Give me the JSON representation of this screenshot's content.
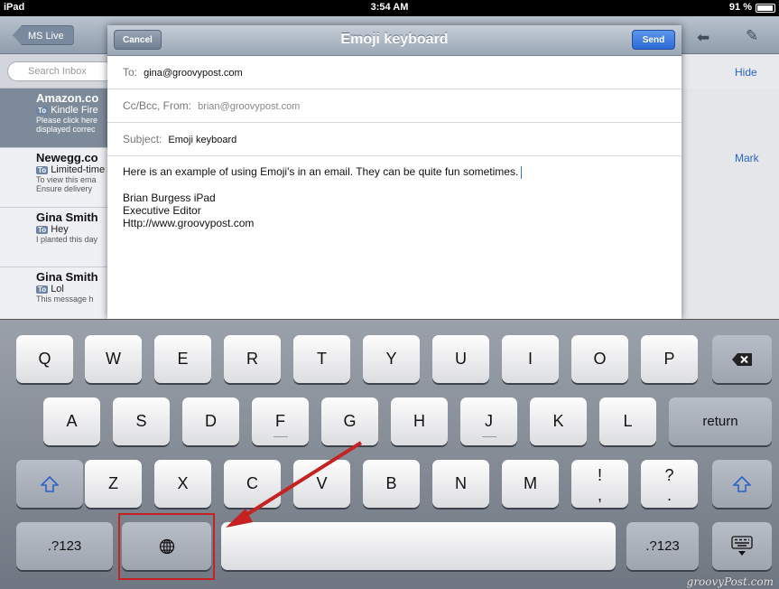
{
  "status_bar": {
    "device": "iPad",
    "time": "3:54 AM",
    "battery": "91 %"
  },
  "inbox": {
    "back_label": "MS Live",
    "search_placeholder": "Search Inbox",
    "hide_label": "Hide",
    "mark_label": "Mark",
    "messages": [
      {
        "from": "Amazon.co",
        "subject": "Kindle Fire",
        "preview1": "Please click here",
        "preview2": "displayed correc"
      },
      {
        "from": "Newegg.co",
        "subject": "Limited-time",
        "preview1": "To view this ema",
        "preview2": "Ensure delivery"
      },
      {
        "from": "Gina Smith",
        "subject": "Hey",
        "preview1": "I planted this day",
        "preview2": ""
      },
      {
        "from": "Gina Smith",
        "subject": "Lol",
        "preview1": "This message h",
        "preview2": ""
      }
    ]
  },
  "compose": {
    "cancel_label": "Cancel",
    "title": "Emoji keyboard",
    "send_label": "Send",
    "to_label": "To:",
    "to_value": "gina@groovypost.com",
    "ccbcc_label": "Cc/Bcc, From:",
    "from_value": "brian@groovypost.com",
    "subject_label": "Subject:",
    "subject_value": "Emoji keyboard",
    "body_line": "Here is an example of using Emoji's in an email. They can be quite fun sometimes.",
    "signature": [
      "Brian Burgess iPad",
      "Executive Editor",
      "Http://www.groovypost.com"
    ]
  },
  "keyboard": {
    "row1": [
      "Q",
      "W",
      "E",
      "R",
      "T",
      "Y",
      "U",
      "I",
      "O",
      "P"
    ],
    "row2": [
      "A",
      "S",
      "D",
      "F",
      "G",
      "H",
      "J",
      "K",
      "L"
    ],
    "row3": [
      "Z",
      "X",
      "C",
      "V",
      "B",
      "N",
      "M"
    ],
    "row3_punct": [
      {
        "top": "!",
        "bottom": ","
      },
      {
        "top": "?",
        "bottom": "."
      }
    ],
    "return_label": "return",
    "numbers_label": ".?123",
    "globe_icon": "globe-icon",
    "shift_icon": "shift-icon",
    "delete_icon": "delete-icon",
    "hide_keyboard_icon": "hide-keyboard-icon"
  },
  "annotation": {
    "highlight_color": "#c62222"
  },
  "watermark": "groovyPost.com"
}
